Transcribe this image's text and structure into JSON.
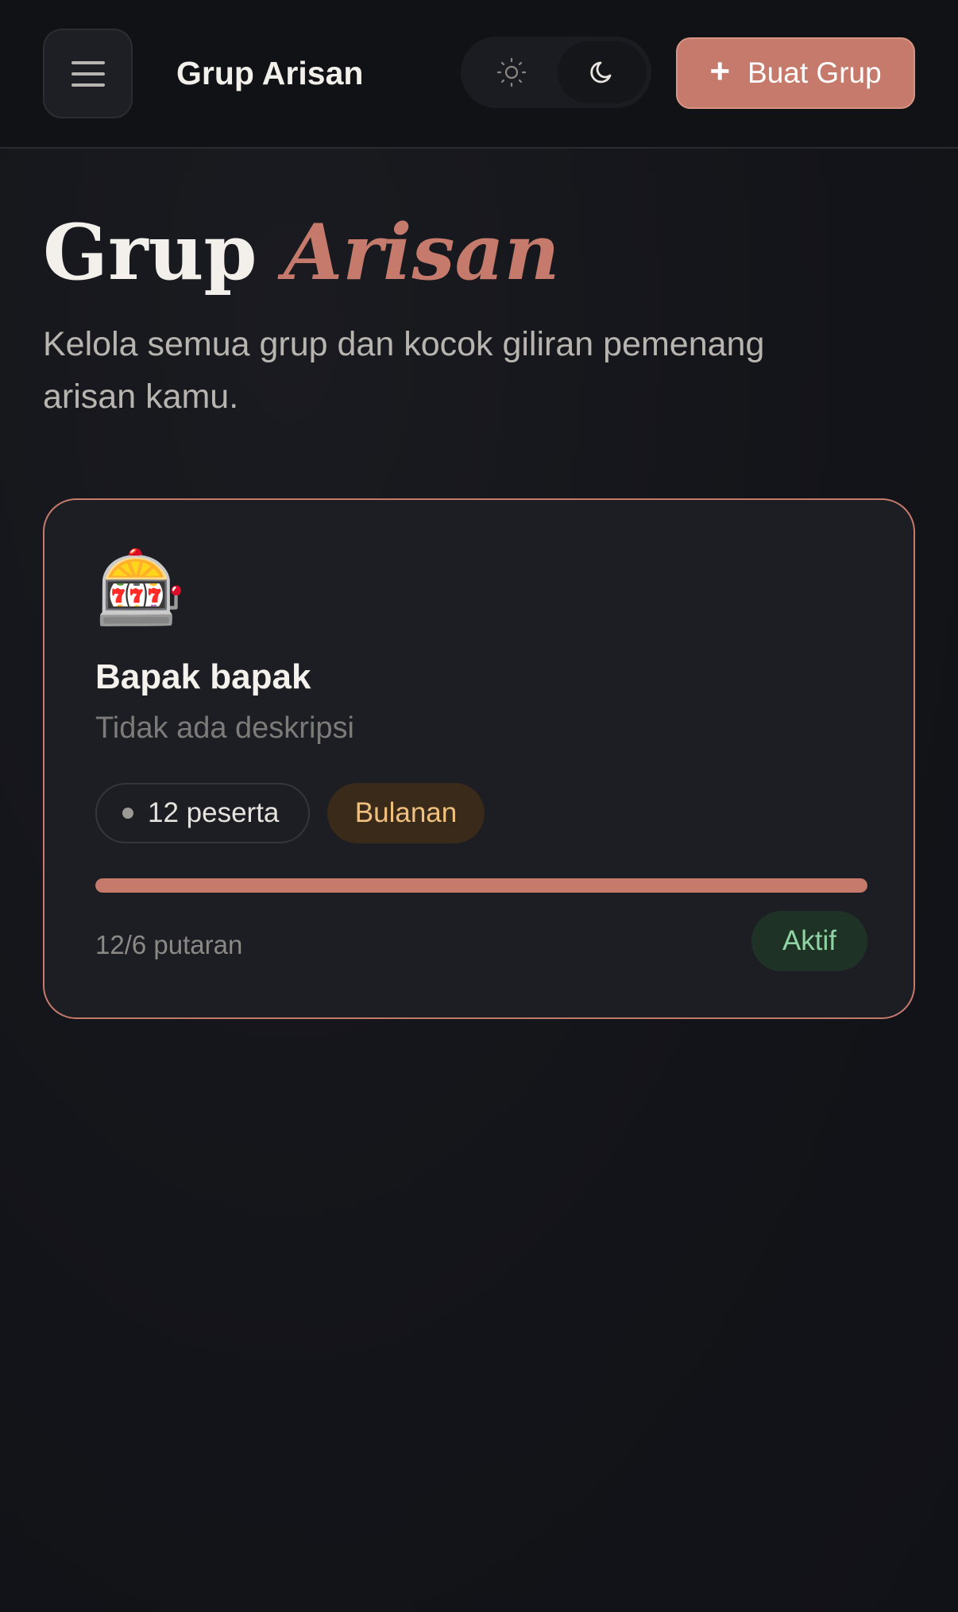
{
  "header": {
    "app_title": "Grup Arisan",
    "create_button_label": "Buat Grup",
    "theme_options": [
      "light",
      "dark"
    ],
    "active_theme": "dark",
    "menu_icon": "hamburger-menu-icon"
  },
  "hero": {
    "title_main": "Grup",
    "title_accent": "Arisan",
    "subtitle": "Kelola semua grup dan kocok giliran pemenang arisan kamu."
  },
  "groups": [
    {
      "icon": "slot-machine-icon",
      "emoji": "🎰",
      "name": "Bapak bapak",
      "description": "Tidak ada deskripsi",
      "members_label": "12 peserta",
      "period_label": "Bulanan",
      "progress_fraction": 1.0,
      "rounds_label": "12/6 putaran",
      "status_label": "Aktif"
    }
  ],
  "colors": {
    "accent": "#c57a6c",
    "background": "#131419",
    "card": "#1d1e23",
    "status_active_bg": "#1e3326",
    "status_active_text": "#8fd3a4",
    "period_bg": "#3a2a1a",
    "period_text": "#f0c07f"
  }
}
